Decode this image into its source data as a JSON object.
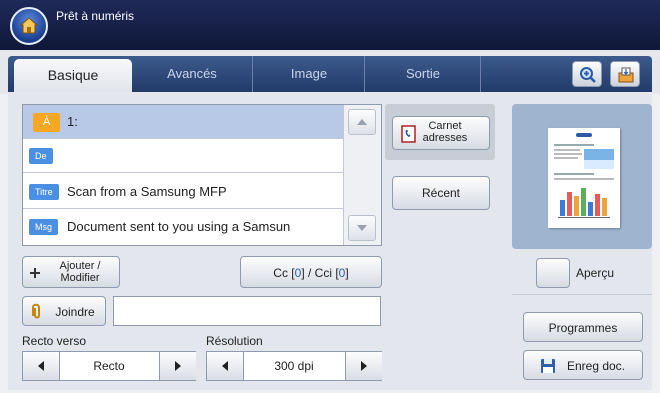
{
  "header": {
    "status": "Prêt à numéris"
  },
  "tabs": [
    {
      "label": "Basique",
      "active": true
    },
    {
      "label": "Avancés",
      "active": false
    },
    {
      "label": "Image",
      "active": false
    },
    {
      "label": "Sortie",
      "active": false
    }
  ],
  "header_buttons": {
    "zoom_icon": "zoom-in-icon",
    "job_icon": "job-status-icon"
  },
  "address": {
    "to_tag": "À",
    "to_value": "1:",
    "from_tag": "De",
    "from_value": "",
    "subject_tag": "Titre",
    "subject_value": "Scan from a Samsung MFP",
    "message_tag": "Msg",
    "message_value": "Document sent to you using a Samsun"
  },
  "buttons": {
    "address_book_line1": "Carnet",
    "address_book_line2": "adresses",
    "recent": "Récent",
    "add_modify_line1": "Ajouter /",
    "add_modify_line2": "Modifier",
    "cc_prefix": "Cc [",
    "cc_count": "0",
    "cc_mid": "] / Cci [",
    "bcc_count": "0",
    "cc_suffix": "]",
    "attach": "Joindre",
    "preview": "Aperçu",
    "programs": "Programmes",
    "save_doc": "Enreg doc."
  },
  "attach_value": "",
  "duplex": {
    "label": "Recto verso",
    "value": "Recto"
  },
  "resolution": {
    "label": "Résolution",
    "value": "300 dpi"
  },
  "colors": {
    "header": "#1f2a5a",
    "tab_strip": "#2e4a7c",
    "tag_blue": "#4b8fe2",
    "tag_orange": "#f6a723",
    "selected_row": "#b8c9e8"
  }
}
